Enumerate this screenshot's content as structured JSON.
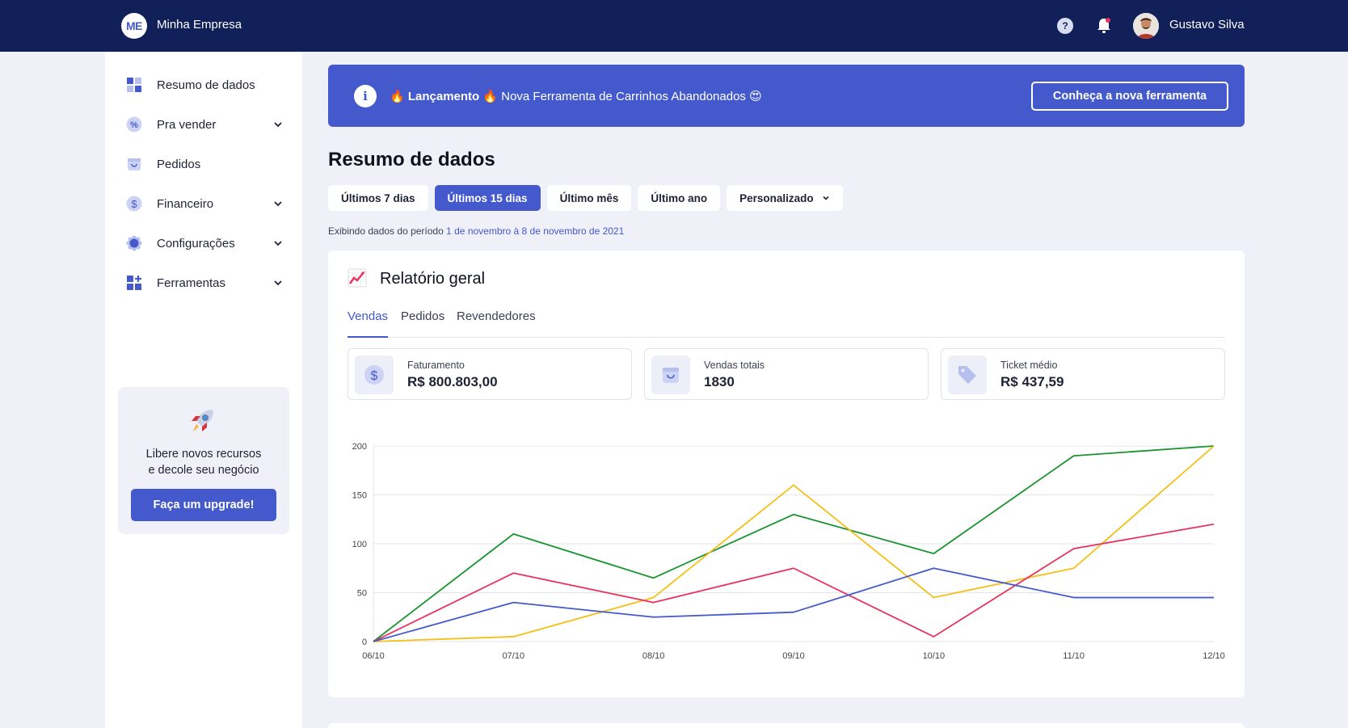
{
  "header": {
    "logo_initials": "ME",
    "company": "Minha Empresa",
    "help_icon": "question-circle-icon",
    "help_glyph": "?",
    "bell_icon": "bell-icon",
    "user_name": "Gustavo Silva"
  },
  "sidebar": {
    "items": [
      {
        "label": "Resumo de dados",
        "icon": "dashboard-grid-icon",
        "expandable": false
      },
      {
        "label": "Pra vender",
        "icon": "percent-icon",
        "expandable": true
      },
      {
        "label": "Pedidos",
        "icon": "shopping-bag-icon",
        "expandable": false
      },
      {
        "label": "Financeiro",
        "icon": "dollar-icon",
        "expandable": true
      },
      {
        "label": "Configurações",
        "icon": "gear-icon",
        "expandable": true
      },
      {
        "label": "Ferramentas",
        "icon": "apps-plus-icon",
        "expandable": true
      }
    ],
    "upgrade": {
      "line1": "Libere novos recursos",
      "line2": "e decole seu negócio",
      "button": "Faça um upgrade!",
      "icon": "rocket-icon"
    }
  },
  "banner": {
    "info_icon": "info-icon",
    "info_glyph": "i",
    "fire": "🔥",
    "bold": "Lançamento",
    "text": "Nova Ferramenta de Carrinhos Abandonados",
    "emoji_end": "😍",
    "button": "Conheça a nova ferramenta"
  },
  "page": {
    "title": "Resumo de dados",
    "periods": [
      "Últimos 7 dias",
      "Últimos 15 dias",
      "Último mês",
      "Último ano",
      "Personalizado"
    ],
    "active_period": 1,
    "info_prefix": "Exibindo dados do período",
    "info_range": "1 de novembro à 8 de novembro de 2021"
  },
  "report": {
    "title": "Relatório geral",
    "icon": "chart-increasing-icon",
    "tabs": [
      "Vendas",
      "Pedidos",
      "Revendedores"
    ],
    "active_tab": 0,
    "stats": [
      {
        "label": "Faturamento",
        "value": "R$ 800.803,00",
        "icon": "dollar-icon"
      },
      {
        "label": "Vendas totais",
        "value": "1830",
        "icon": "shopping-bag-icon"
      },
      {
        "label": "Ticket médio",
        "value": "R$ 437,59",
        "icon": "tag-icon"
      }
    ]
  },
  "colors": {
    "primary": "#4459cc",
    "navy": "#12205a",
    "green": "#1a9431",
    "yellow": "#f5bf14",
    "red": "#e8335f",
    "blue": "#4459cc"
  },
  "chart_data": {
    "type": "line",
    "x": [
      "06/10",
      "07/10",
      "08/10",
      "09/10",
      "10/10",
      "11/10",
      "12/10"
    ],
    "ylim": [
      0,
      200
    ],
    "yticks": [
      0,
      50,
      100,
      150,
      200
    ],
    "grid": true,
    "series": [
      {
        "color": "#1a9431",
        "values": [
          0,
          110,
          65,
          130,
          90,
          190,
          200
        ]
      },
      {
        "color": "#f5bf14",
        "values": [
          0,
          5,
          45,
          160,
          45,
          75,
          200
        ]
      },
      {
        "color": "#e8335f",
        "values": [
          0,
          70,
          40,
          75,
          5,
          95,
          120
        ]
      },
      {
        "color": "#4459cc",
        "values": [
          0,
          40,
          25,
          30,
          75,
          45,
          45
        ]
      }
    ]
  }
}
